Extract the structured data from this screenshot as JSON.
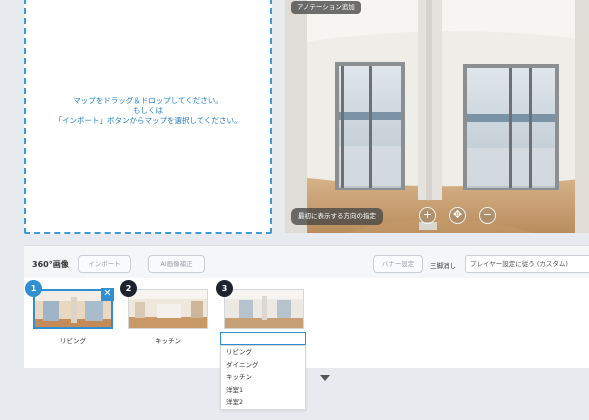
{
  "map_panel": {
    "drop_line1": "マップをドラッグ＆ドロップしてください。",
    "drop_line2": "もしくは",
    "drop_line3": "「インポート」ボタンからマップを選択してください。"
  },
  "viewer": {
    "add_annotation_label": "アノテーション追加",
    "initial_direction_label": "最初に表示する方向の指定",
    "controls": [
      {
        "icon": "zoom-in-icon",
        "glyph": "+"
      },
      {
        "icon": "compass-icon",
        "glyph": "✥"
      },
      {
        "icon": "zoom-out-icon",
        "glyph": "−"
      }
    ]
  },
  "image_panel": {
    "title": "360°画像",
    "import_label": "インポート",
    "ai_correction_label": "AI画像補正",
    "banner_settings_label": "バナー設定",
    "tripod_removal_label": "三脚消し",
    "tripod_removal_value": "プレイヤー設定に従う (カスタム)",
    "thumbnails": [
      {
        "number": "1",
        "label": "リビング",
        "selected": true
      },
      {
        "number": "2",
        "label": "キッチン",
        "selected": false
      },
      {
        "number": "3",
        "label": "",
        "selected": false
      }
    ],
    "name_input_value": "",
    "name_suggestions": [
      "リビング",
      "ダイニング",
      "キッチン",
      "洋室1",
      "洋室2"
    ]
  },
  "colors": {
    "accent": "#2f8fd0",
    "drop_text": "#1f7fc6",
    "page_bg": "#e7ebef"
  }
}
